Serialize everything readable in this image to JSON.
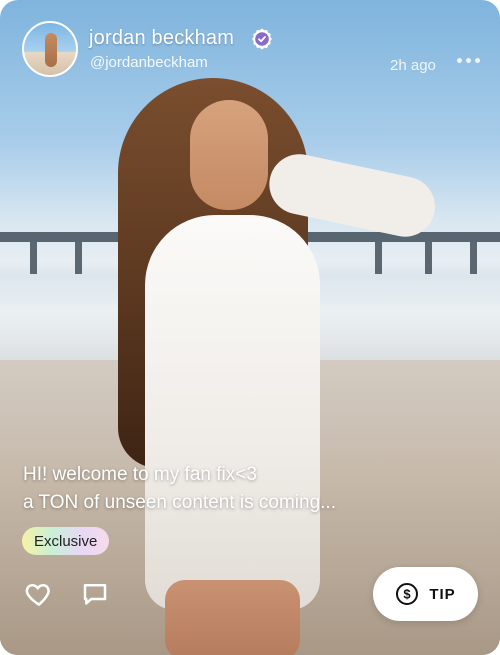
{
  "post": {
    "author_name": "jordan beckham",
    "author_handle": "@jordanbeckham",
    "time_ago": "2h ago",
    "caption_line1": "HI! welcome to my fan fix<3",
    "caption_line2": "a TON of unseen content is coming...",
    "badge": "Exclusive",
    "tip_label": "TIP"
  },
  "icons": {
    "verified": "verified-badge-icon",
    "more": "more-dots-icon",
    "like": "heart-icon",
    "comment": "comment-icon",
    "tip": "dollar-coin-icon"
  },
  "colors": {
    "verified_badge": "#8a6cc8",
    "tip_button": "#ffffff"
  }
}
